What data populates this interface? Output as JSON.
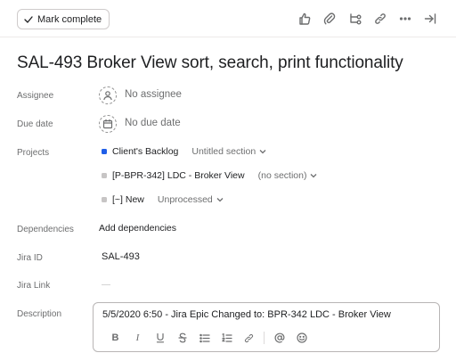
{
  "toolbar": {
    "mark_complete_label": "Mark complete",
    "icons": [
      "thumbs-up-icon",
      "attachment-icon",
      "subtask-icon",
      "link-icon",
      "more-icon",
      "close-pane-icon"
    ]
  },
  "task": {
    "title": "SAL-493 Broker View sort, search, print functionality"
  },
  "fields": {
    "assignee": {
      "label": "Assignee",
      "value": "No assignee"
    },
    "due_date": {
      "label": "Due date",
      "value": "No due date"
    },
    "projects": {
      "label": "Projects",
      "items": [
        {
          "name": "Client's Backlog",
          "section": "Untitled section",
          "color": "#1f5ee8"
        },
        {
          "name": "[P-BPR-342] LDC - Broker View",
          "section": "(no section)",
          "color": "#c7c5c5"
        },
        {
          "name": "[~] New",
          "section": "Unprocessed",
          "color": "#c7c5c5"
        }
      ]
    },
    "dependencies": {
      "label": "Dependencies",
      "action": "Add dependencies"
    },
    "jira_id": {
      "label": "Jira ID",
      "value": "SAL-493"
    },
    "jira_link": {
      "label": "Jira Link",
      "value": "—"
    },
    "description": {
      "label": "Description",
      "value": "5/5/2020 6:50 - Jira Epic Changed to:  BPR-342 LDC - Broker View",
      "format_tools": [
        "bold-icon",
        "italic-icon",
        "underline-icon",
        "strikethrough-icon",
        "bullet-list-icon",
        "numbered-list-icon",
        "link-icon",
        "mention-icon",
        "emoji-icon"
      ],
      "bold_glyph": "B",
      "italic_glyph": "I"
    }
  },
  "colors": {
    "accent": "#1f5ee8",
    "text": "#1e1f21",
    "muted": "#6d6e6f"
  }
}
